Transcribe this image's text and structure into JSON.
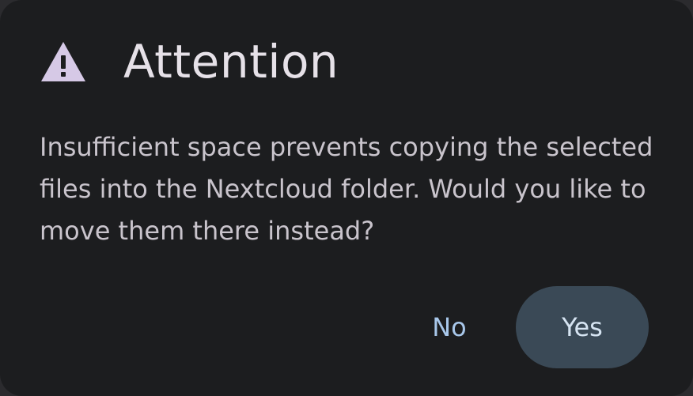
{
  "dialog": {
    "icon": "warning-triangle-icon",
    "title": "Attention",
    "message": "Insufficient space prevents copying the selected files into the Nextcloud folder. Would you like to move them there instead?",
    "buttons": {
      "no_label": "No",
      "yes_label": "Yes"
    }
  },
  "colors": {
    "background": "#1c1d1f",
    "icon": "#d6c9e6",
    "accent_text": "#a8c7ea",
    "primary_button": "#3a4956"
  }
}
